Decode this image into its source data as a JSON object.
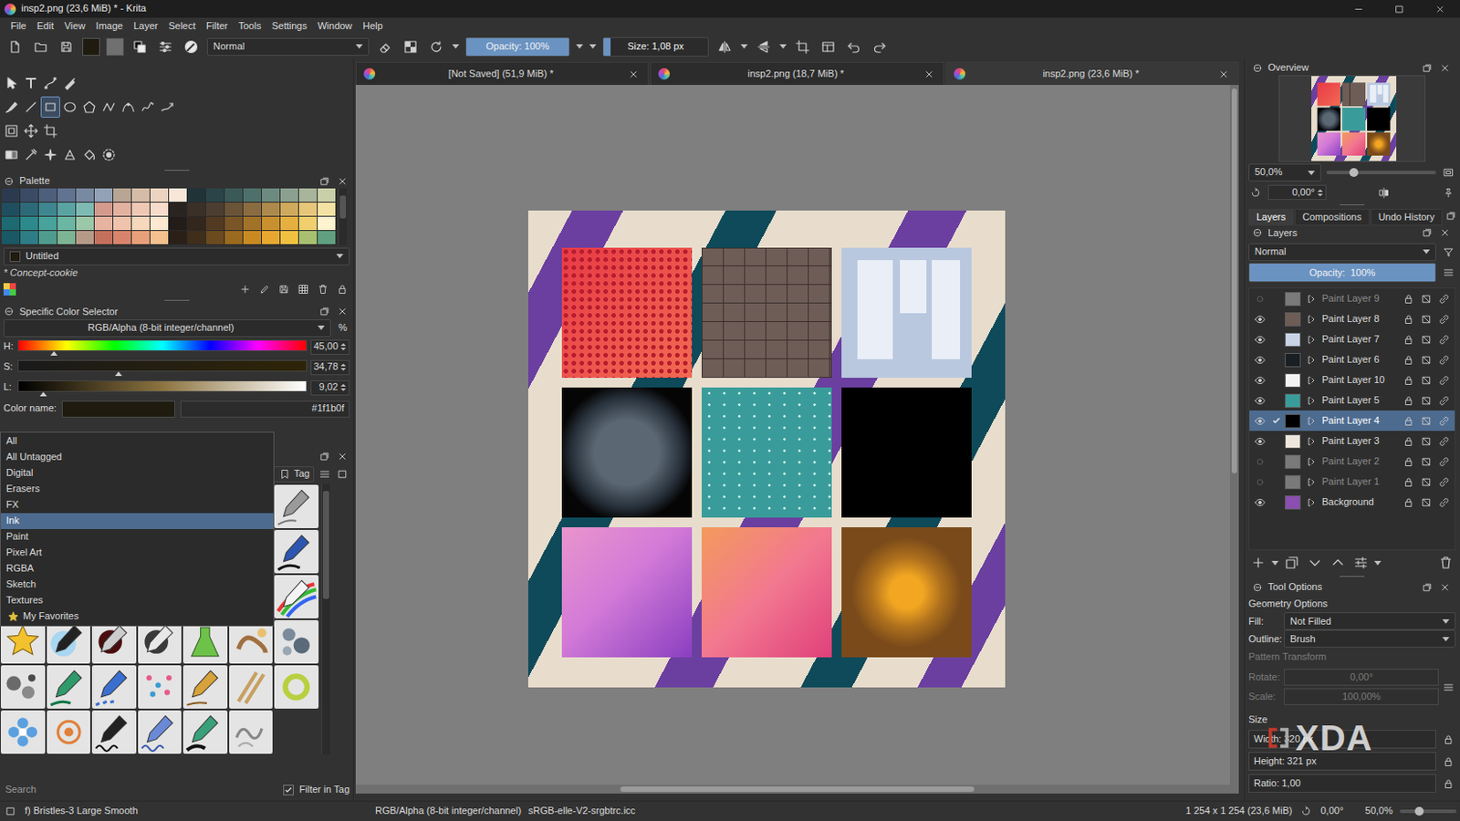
{
  "window": {
    "title": "insp2.png (23,6 MiB) * - Krita"
  },
  "menu": [
    "File",
    "Edit",
    "View",
    "Image",
    "Layer",
    "Select",
    "Filter",
    "Tools",
    "Settings",
    "Window",
    "Help"
  ],
  "toolbar": {
    "blend_mode": "Normal",
    "opacity": {
      "label": "Opacity: 100%",
      "level": 1
    },
    "size": {
      "label": "Size: 1,08 px",
      "level": 0.07
    }
  },
  "tools": [
    [
      {
        "kind": "select-shapes",
        "selected": false
      },
      {
        "kind": "text",
        "selected": false
      },
      {
        "kind": "edit-shapes",
        "selected": false
      },
      {
        "kind": "calligraphy",
        "selected": false
      }
    ],
    [
      {
        "kind": "freehand-brush",
        "selected": false
      },
      {
        "kind": "line",
        "selected": false
      },
      {
        "kind": "rectangle",
        "selected": true
      },
      {
        "kind": "ellipse",
        "selected": false
      },
      {
        "kind": "polygon",
        "selected": false
      },
      {
        "kind": "polyline",
        "selected": false
      },
      {
        "kind": "bezier",
        "selected": false
      },
      {
        "kind": "freehand-path",
        "selected": false
      },
      {
        "kind": "dynamic-brush",
        "selected": false
      }
    ],
    [
      {
        "kind": "transform",
        "selected": false
      },
      {
        "kind": "move",
        "selected": false
      },
      {
        "kind": "crop",
        "selected": false
      }
    ],
    [
      {
        "kind": "gradient",
        "selected": false
      },
      {
        "kind": "color-picker",
        "selected": false
      },
      {
        "kind": "smart-patch",
        "selected": false
      },
      {
        "kind": "fill-assist",
        "selected": false
      },
      {
        "kind": "fill",
        "selected": false
      },
      {
        "kind": "enclosed-fill",
        "selected": false
      }
    ]
  ],
  "palette": {
    "title": "Palette",
    "swatches": [
      "#2c3a4f",
      "#3b4b66",
      "#4d5f7d",
      "#617390",
      "#7889a2",
      "#93a2b6",
      "#b8a594",
      "#d5bca8",
      "#ecd4c0",
      "#f8e6d8",
      "#1f3338",
      "#2b4447",
      "#3b5959",
      "#4e706b",
      "#6d8a80",
      "#8ba08f",
      "#a8b59b",
      "#c9cfa8",
      "#1f4f5e",
      "#2d6a78",
      "#3f8790",
      "#5aa3a3",
      "#7dbab2",
      "#d49a8e",
      "#e3b1a0",
      "#efc8b4",
      "#f8dccb",
      "#2a2420",
      "#3a3028",
      "#4c3e30",
      "#6a5438",
      "#8a6c40",
      "#ad8a4c",
      "#cfa95c",
      "#e6c77a",
      "#f4e2a4",
      "#1d6a72",
      "#2c8a8c",
      "#48a39c",
      "#6cb6a4",
      "#9bc8a8",
      "#e8b4a2",
      "#f0c4ac",
      "#f6d8bc",
      "#fde9d2",
      "#231c18",
      "#33261c",
      "#523a22",
      "#7a5626",
      "#a27228",
      "#c8902e",
      "#e6b040",
      "#f2cf6e",
      "#fff4d0",
      "#1a5866",
      "#2d7c86",
      "#4f9c8e",
      "#7cb494",
      "#b59a88",
      "#c4705e",
      "#d8846c",
      "#e8a07a",
      "#f3c08e",
      "#2a2018",
      "#3f2e1a",
      "#6b4a1e",
      "#9a6a1e",
      "#c88a20",
      "#e8a830",
      "#f0c040",
      "#a8c070",
      "#60a080"
    ],
    "name": "Untitled",
    "resource": "* Concept-cookie"
  },
  "color_selector": {
    "title": "Specific Color Selector",
    "model": "RGB/Alpha (8-bit integer/channel)",
    "percent": "%",
    "channels": [
      {
        "label": "H:",
        "value": "45,00",
        "level": 0.125,
        "kind": "hue"
      },
      {
        "label": "S:",
        "value": "34,78",
        "level": 0.35,
        "kind": "saturation"
      },
      {
        "label": "L:",
        "value": "9,02",
        "level": 0.09,
        "kind": "lightness"
      }
    ],
    "name_label": "Color name:",
    "hex": "#1f1b0f"
  },
  "brush_presets": {
    "tag_button": "Tag",
    "tags": [
      {
        "label": "All",
        "selected": false,
        "starred": false
      },
      {
        "label": "All Untagged",
        "selected": false,
        "starred": false
      },
      {
        "label": "Digital",
        "selected": false,
        "starred": false
      },
      {
        "label": "Erasers",
        "selected": false,
        "starred": false
      },
      {
        "label": "FX",
        "selected": false,
        "starred": false
      },
      {
        "label": "Ink",
        "selected": true,
        "starred": false
      },
      {
        "label": "Paint",
        "selected": false,
        "starred": false
      },
      {
        "label": "Pixel Art",
        "selected": false,
        "starred": false
      },
      {
        "label": "RGBA",
        "selected": false,
        "starred": false
      },
      {
        "label": "Sketch",
        "selected": false,
        "starred": false
      },
      {
        "label": "Textures",
        "selected": false,
        "starred": false
      },
      {
        "label": "My Favorites",
        "selected": false,
        "starred": true
      }
    ],
    "thumbnails": [
      {
        "kind": "pencil"
      },
      {
        "kind": "ink"
      },
      {
        "kind": "rainbow"
      },
      {
        "kind": "star"
      },
      {
        "kind": "airbrush"
      },
      {
        "kind": "blender"
      },
      {
        "kind": "ballpen"
      },
      {
        "kind": "flask"
      },
      {
        "kind": "swirl"
      },
      {
        "kind": "blobs"
      },
      {
        "kind": "blobs2"
      },
      {
        "kind": "greenpen"
      },
      {
        "kind": "dotpen"
      },
      {
        "kind": "dots"
      },
      {
        "kind": "yellowpencil"
      },
      {
        "kind": "sticks"
      },
      {
        "kind": "ring"
      },
      {
        "kind": "flower"
      },
      {
        "kind": "target"
      },
      {
        "kind": "scribble"
      },
      {
        "kind": "wave"
      },
      {
        "kind": "inkpen"
      },
      {
        "kind": "curls"
      }
    ],
    "search_placeholder": "Search",
    "filter_in_tag": {
      "label": "Filter in Tag",
      "checked": true
    }
  },
  "documents": [
    {
      "label": "[Not Saved] (51,9 MiB) *",
      "selected": false
    },
    {
      "label": "insp2.png (18,7 MiB) *",
      "selected": false
    },
    {
      "label": "insp2.png (23,6 MiB) *",
      "selected": true
    }
  ],
  "overview": {
    "title": "Overview",
    "zoom": "50,0%",
    "zoom_level": 0.25,
    "rotation": "0,00°"
  },
  "panel_tabs": [
    {
      "label": "Layers",
      "selected": true
    },
    {
      "label": "Compositions",
      "selected": false
    },
    {
      "label": "Undo History",
      "selected": false
    }
  ],
  "layers": {
    "title": "Layers",
    "blend_mode": "Normal",
    "opacity": {
      "label": "Opacity:  100%",
      "level": 1
    },
    "items": [
      {
        "name": "Paint Layer 9",
        "visible": false,
        "checked": false,
        "selected": false,
        "color": "#7a7a7a"
      },
      {
        "name": "Paint Layer 8",
        "visible": true,
        "checked": false,
        "selected": false,
        "color": "#6e5c57"
      },
      {
        "name": "Paint Layer 7",
        "visible": true,
        "checked": false,
        "selected": false,
        "color": "#c8d4e6"
      },
      {
        "name": "Paint Layer 6",
        "visible": true,
        "checked": false,
        "selected": false,
        "color": "#1a1f24"
      },
      {
        "name": "Paint Layer 10",
        "visible": true,
        "checked": false,
        "selected": false,
        "color": "#f2f2f2"
      },
      {
        "name": "Paint Layer 5",
        "visible": true,
        "checked": false,
        "selected": false,
        "color": "#3a9c9a"
      },
      {
        "name": "Paint Layer 4",
        "visible": true,
        "checked": true,
        "selected": true,
        "color": "#000000"
      },
      {
        "name": "Paint Layer 3",
        "visible": true,
        "checked": false,
        "selected": false,
        "color": "#ece6dc"
      },
      {
        "name": "Paint Layer 2",
        "visible": false,
        "checked": false,
        "selected": false,
        "color": "#7a7a7a"
      },
      {
        "name": "Paint Layer 1",
        "visible": false,
        "checked": false,
        "selected": false,
        "color": "#7a7a7a"
      },
      {
        "name": "Background",
        "visible": true,
        "checked": false,
        "selected": false,
        "color": "#8a4fb0"
      }
    ]
  },
  "tool_options": {
    "title": "Tool Options",
    "section": "Geometry Options",
    "fields": [
      {
        "label": "Fill:",
        "value": "Not Filled"
      },
      {
        "label": "Outline:",
        "value": "Brush"
      }
    ],
    "pattern": {
      "title": "Pattern Transform",
      "disabled": true,
      "rotate": {
        "label": "Rotate:",
        "value": "0,00°"
      },
      "scale": {
        "label": "Scale:",
        "value": "100,00%"
      }
    },
    "size": {
      "title": "Size",
      "fields": [
        {
          "label": "Width:",
          "value": "320 px"
        },
        {
          "label": "Height:",
          "value": "321 px"
        },
        {
          "label": "Ratio:",
          "value": "1,00"
        }
      ]
    }
  },
  "status_bar": {
    "preset": "f) Bristles-3 Large Smooth",
    "color_space": "RGB/Alpha (8-bit integer/channel)",
    "profile": "sRGB-elle-V2-srgbtrc.icc",
    "dimensions": "1 254 x 1 254 (23,6 MiB)",
    "rotation": "0,00°",
    "zoom": "50,0%",
    "zoom_level": 0.35
  },
  "watermark": "XDA"
}
